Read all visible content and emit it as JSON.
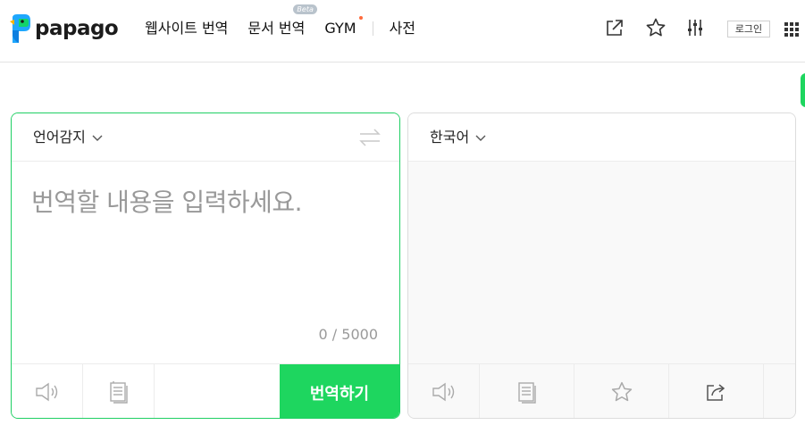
{
  "brand": {
    "name": "papago"
  },
  "nav": {
    "items": [
      {
        "label": "웹사이트 번역"
      },
      {
        "label": "문서 번역",
        "badge": "Beta"
      },
      {
        "label": "GYM"
      },
      {
        "label": "사전"
      }
    ]
  },
  "toolbar": {
    "icons": [
      "external-link-icon",
      "star-icon",
      "settings-sliders-icon",
      "apps-grid-icon"
    ],
    "login_label": "로그인"
  },
  "source": {
    "language": "언어감지",
    "placeholder": "번역할 내용을 입력하세요.",
    "char_count": "0 / 5000",
    "translate_label": "번역하기"
  },
  "target": {
    "language": "한국어"
  },
  "colors": {
    "accent": "#1ed65f",
    "accent_border": "#1fcf63",
    "gym_dot": "#ff6a3c"
  }
}
